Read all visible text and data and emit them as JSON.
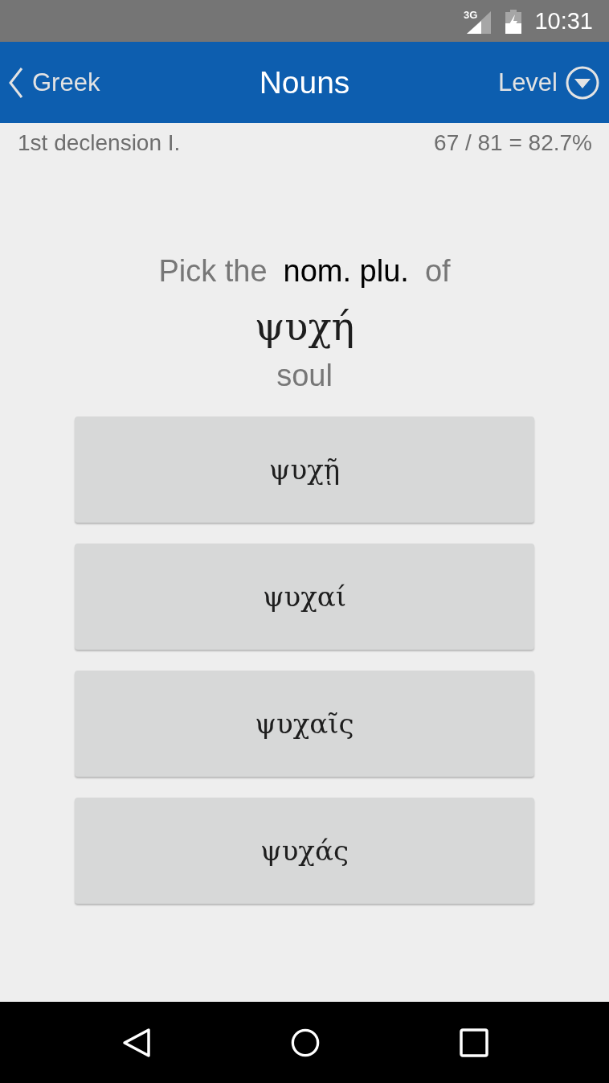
{
  "status_bar": {
    "network": "3G",
    "time": "10:31"
  },
  "header": {
    "back_label": "Greek",
    "title": "Nouns",
    "level_label": "Level"
  },
  "subheader": {
    "lesson": "1st declension I.",
    "score": "67 / 81 = 82.7%"
  },
  "question": {
    "prefix": "Pick the",
    "form": "nom. plu.",
    "suffix": "of",
    "word": "ψυχή",
    "meaning": "soul"
  },
  "options": [
    {
      "label": "ψυχῇ"
    },
    {
      "label": "ψυχαί"
    },
    {
      "label": "ψυχαῖς"
    },
    {
      "label": "ψυχάς"
    }
  ]
}
